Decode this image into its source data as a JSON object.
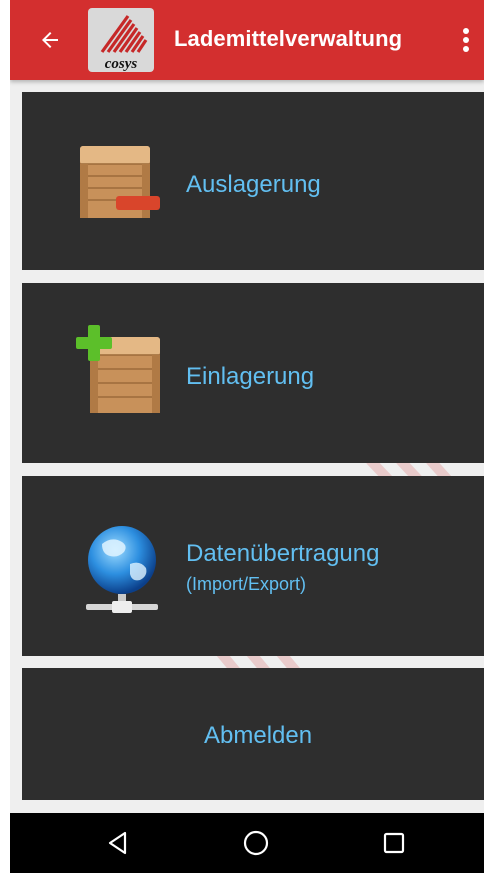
{
  "app_bar": {
    "title": "Lademittelverwaltung",
    "back_icon": "arrow-back-icon",
    "logo_text": "cosys",
    "overflow_icon": "more-vertical-icon",
    "background_color": "#d32f2f"
  },
  "menu": {
    "items": [
      {
        "label": "Auslagerung",
        "icon": "crate-minus-icon"
      },
      {
        "label": "Einlagerung",
        "icon": "crate-plus-icon"
      },
      {
        "label": "Datenübertragung",
        "sublabel": "(Import/Export)",
        "icon": "globe-network-icon"
      },
      {
        "label": "Abmelden"
      }
    ],
    "card_color": "#2e2e2e",
    "label_color": "#62bff1"
  },
  "nav_bar": {
    "back_icon": "nav-back-icon",
    "home_icon": "nav-home-icon",
    "recents_icon": "nav-recents-icon"
  }
}
